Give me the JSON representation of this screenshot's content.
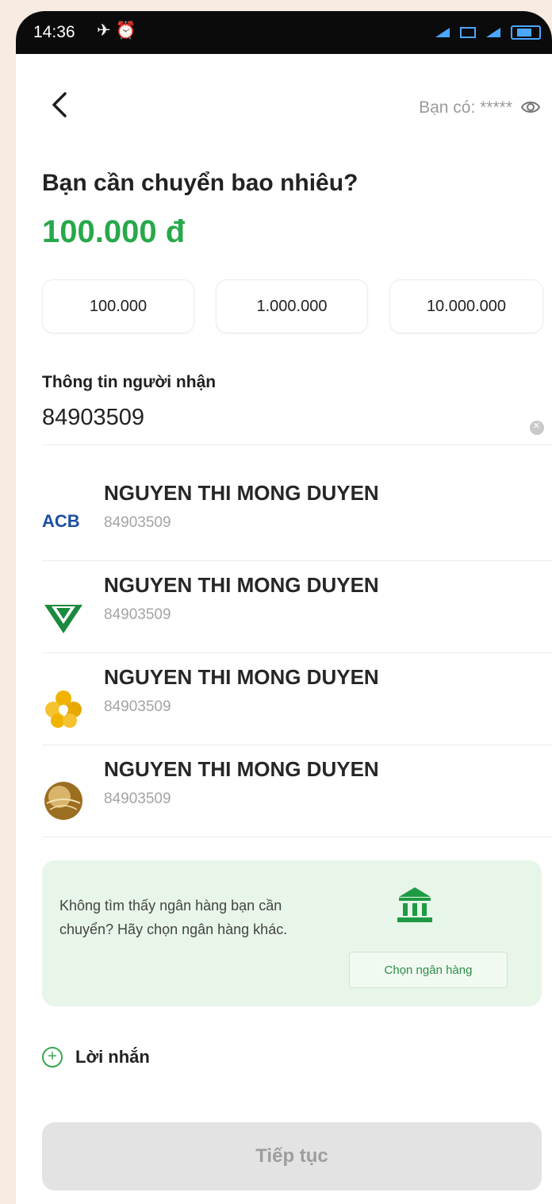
{
  "status_bar": {
    "time": "14:36",
    "left_icons": [
      "notification-icon",
      "alarm-icon"
    ],
    "right_icons": [
      "signal-icon",
      "lte-icon",
      "signal-icon",
      "battery-icon"
    ]
  },
  "header": {
    "balance_text": "Bạn có: *****"
  },
  "title": "Bạn cần chuyển bao nhiêu?",
  "amount": "100.000 đ",
  "quick_amounts": [
    "100.000",
    "1.000.000",
    "10.000.000"
  ],
  "recipient": {
    "label": "Thông tin người nhận",
    "input_value": "84903509",
    "results": [
      {
        "bank_logo": "ACB",
        "name": "NGUYEN THI MONG DUYEN",
        "account": "84903509"
      },
      {
        "bank_logo": "vietcombank-logo",
        "name": "NGUYEN THI MONG DUYEN",
        "account": "84903509"
      },
      {
        "bank_logo": "gold-flower-logo",
        "name": "NGUYEN THI MONG DUYEN",
        "account": "84903509"
      },
      {
        "bank_logo": "gold-sphere-logo",
        "name": "NGUYEN THI MONG DUYEN",
        "account": "84903509"
      }
    ]
  },
  "bank_panel": {
    "message": "Không tìm thấy ngân hàng bạn cần chuyển? Hãy chọn ngân hàng khác.",
    "button": "Chọn ngân hàng"
  },
  "note_label": "Lời nhắn",
  "submit_label": "Tiếp tục",
  "colors": {
    "accent": "#27a84a",
    "panel_bg": "#e8f6e9",
    "disabled_button": "#e3e3e3"
  }
}
